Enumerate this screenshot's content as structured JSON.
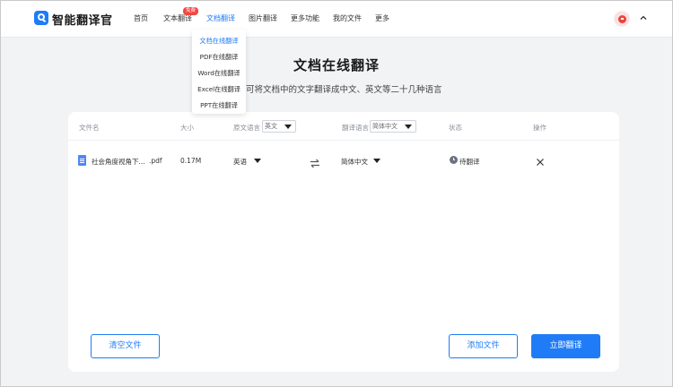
{
  "header": {
    "brand": "智能翻译官",
    "nav": [
      "首页",
      "文本翻译",
      "文档翻译",
      "图片翻译",
      "更多功能",
      "我的文件",
      "更多"
    ],
    "badge": "免费",
    "active_index": 2
  },
  "dropdown": {
    "items": [
      "文档在线翻译",
      "PDF在线翻译",
      "Word在线翻译",
      "Excel在线翻译",
      "PPT在线翻译"
    ],
    "active_index": 0
  },
  "page": {
    "title": "文档在线翻译",
    "subtitle": "可将文档中的文字翻译成中文、英文等二十几种语言"
  },
  "table": {
    "headers": {
      "filename": "文件名",
      "size": "大小",
      "source_lang": "原文语言",
      "target_lang": "翻译语言",
      "status": "状态",
      "action": "操作"
    },
    "source_select": "英文",
    "target_select": "简体中文",
    "rows": [
      {
        "name": "社会角度视角下...",
        "ext": ".pdf",
        "size": "0.17M",
        "source": "英语",
        "target": "简体中文",
        "status": "待翻译"
      }
    ]
  },
  "buttons": {
    "clear": "清空文件",
    "add": "添加文件",
    "translate": "立即翻译"
  },
  "colors": {
    "accent": "#1f7cf6",
    "badge": "#f2473f",
    "background": "#f2f3f5"
  }
}
